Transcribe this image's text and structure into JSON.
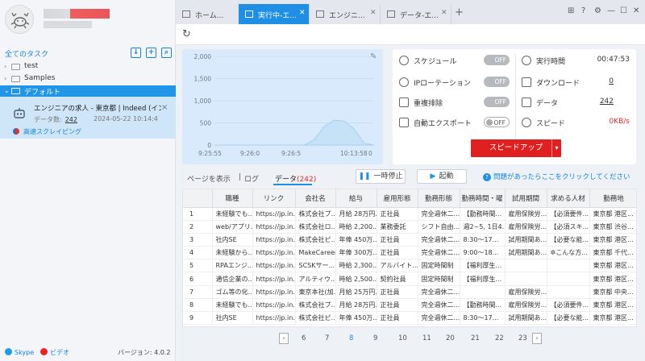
{
  "sidebar": {
    "all_tasks_label": "全てのタスク",
    "folders": [
      {
        "label": "test",
        "selected": false
      },
      {
        "label": "Samples",
        "selected": false
      },
      {
        "label": "デフォルト",
        "selected": true
      }
    ],
    "task": {
      "title": "エンジニアの求人 - 東京都 | Indeed (インデ...",
      "data_count_label": "データ数:",
      "data_count": "242",
      "date": "2024-05-22 10:14:4",
      "speed_mode": "高速スクレイピング"
    },
    "footer": {
      "skype": "Skype",
      "video": "ビデオ",
      "version": "バージョン: 4.0.2"
    }
  },
  "tabs": [
    {
      "label": "ホーム...",
      "active": false,
      "closable": false
    },
    {
      "label": "実行中-エ...",
      "active": true,
      "closable": true
    },
    {
      "label": "エンジニ...",
      "active": false,
      "closable": true
    },
    {
      "label": "データ-エ...",
      "active": false,
      "closable": true
    }
  ],
  "chart_data": {
    "type": "area",
    "y_ticks": [
      "2,000",
      "1,500",
      "1,000",
      "500",
      "0"
    ],
    "x_ticks": [
      "9:25:55",
      "9:26:0",
      "9:26:5",
      "10:13:58",
      "0"
    ],
    "ylim": [
      0,
      2000
    ],
    "series": [
      {
        "values": [
          0,
          0,
          0,
          0,
          0,
          0,
          0,
          0,
          0,
          0,
          120,
          420,
          560,
          540,
          360,
          40,
          0
        ]
      }
    ],
    "color": "#c5e2f7"
  },
  "status": {
    "schedule": {
      "label": "スケジュール",
      "value": "OFF"
    },
    "ip_rotation": {
      "label": "IPローテーション",
      "value": "OFF"
    },
    "dedupe": {
      "label": "重複排除",
      "value": "OFF"
    },
    "auto_export": {
      "label": "自動エクスポート",
      "value": "OFF"
    },
    "run_time": {
      "label": "実行時間",
      "value": "00:47:53"
    },
    "download": {
      "label": "ダウンロード",
      "value": "0"
    },
    "data": {
      "label": "データ",
      "value": "242"
    },
    "speed": {
      "label": "スピード",
      "value": "0KB/s"
    },
    "speedup_button": "スピードアップ"
  },
  "data_tabs": {
    "page_view": "ページを表示",
    "log": "ログ",
    "data": "データ",
    "data_count": "(242)"
  },
  "actions": {
    "pause": "一時停止",
    "start": "起動",
    "help": "問題があったらここをクリックしてください"
  },
  "table": {
    "headers": [
      "",
      "職種",
      "リンク",
      "会社名",
      "給与",
      "雇用形態",
      "勤務形態",
      "勤務時間・曜",
      "試用期間",
      "求める人材",
      "勤務地"
    ],
    "rows": [
      [
        "1",
        "未経験でも...",
        "https://jp.in...",
        "株式会社プ...",
        "月給 28万円...",
        "正社員",
        "完全週休二...",
        "【勤務時間...",
        "雇用保険労...",
        "【必須要件...",
        "東京都 港区..."
      ],
      [
        "2",
        "web/アプリ...",
        "https://jp.in...",
        "株式会社ロ...",
        "時給 2,200...",
        "業務委託",
        "シフト自由...",
        "週2~5, 1日4...",
        "雇用保険労...",
        "【必須スキ...",
        "東京都 渋谷..."
      ],
      [
        "3",
        "社内SE",
        "https://jp.in...",
        "株式会社ピ...",
        "年俸 450万...",
        "正社員",
        "完全週休二...",
        "8:30～17...",
        "試用期間あ...",
        "【必要な能...",
        "東京都 港区..."
      ],
      [
        "4",
        "未経験から...",
        "https://jp.in...",
        "MakeCareer",
        "年俸 300万...",
        "正社員",
        "完全週休二...",
        "9:00～18...",
        "試用期間あ...",
        "✲こんな方...",
        "東京都 千代..."
      ],
      [
        "5",
        "RPAエンジ...",
        "https://jp.in...",
        "SCSKサー...",
        "時給 2,300...",
        "アルバイト...",
        "固定時間制",
        "【福利厚生...",
        "",
        "",
        "東京都 港区..."
      ],
      [
        "6",
        "通信企業の...",
        "https://jp.in...",
        "アルティウ...",
        "時給 2,500...",
        "契約社員",
        "固定時間制",
        "【福利厚生...",
        "",
        "",
        "東京都 港区..."
      ],
      [
        "7",
        "ゴム等の化...",
        "https://jp.in...",
        "東京本社(加...",
        "月給 25万円...",
        "正社員",
        "完全週休二...",
        "",
        "雇用保険労...",
        "",
        "東京都 中央..."
      ],
      [
        "8",
        "未経験でも...",
        "https://jp.in...",
        "株式会社プ...",
        "月給 28万円...",
        "正社員",
        "完全週休二...",
        "【勤務時間...",
        "雇用保険労...",
        "【必須要件...",
        "東京都 港区..."
      ],
      [
        "9",
        "社内SE",
        "https://jp.in...",
        "株式会社ピ...",
        "年俸 450万...",
        "正社員",
        "完全週休二...",
        "8:30～17...",
        "試用期間あ...",
        "【必要な能...",
        "東京都 港区..."
      ]
    ]
  },
  "pagination": {
    "pages": [
      "6",
      "7",
      "8",
      "9",
      "10",
      "11",
      "20",
      "21",
      "22",
      "23"
    ],
    "current": "8"
  }
}
